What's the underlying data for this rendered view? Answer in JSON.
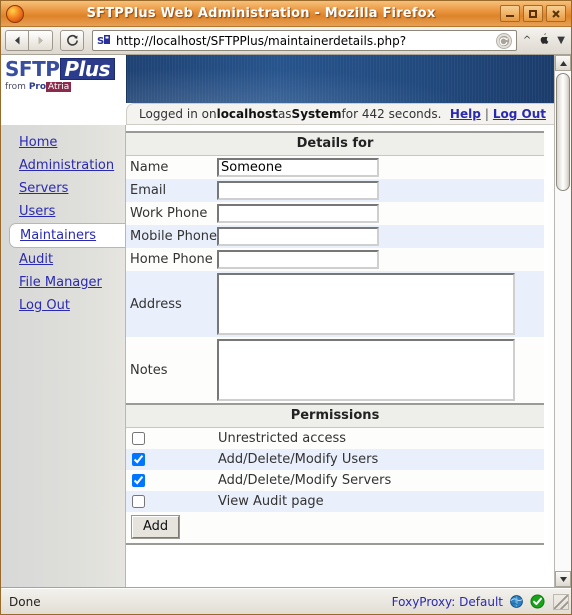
{
  "window": {
    "title": "SFTPPlus Web Administration - Mozilla Firefox",
    "minimize_label": "_",
    "maximize_label": "□",
    "close_label": "✕"
  },
  "toolbar": {
    "back_label": "◀",
    "forward_label": "▶",
    "reload_label": "↻",
    "favicon_label": "S",
    "url": "http://localhost/SFTPPlus/maintainerdetails.php?",
    "go_label": "↺",
    "extra_caret": "^",
    "extra_dropdown": "▼"
  },
  "site": {
    "logo_sftp": "SFTP",
    "logo_plus": "Plus",
    "logo_sub_from": "from ",
    "logo_sub_pro": "Pro",
    "logo_sub_atria": "Atria"
  },
  "login": {
    "prefix": "Logged in on ",
    "host": "localhost",
    "middle": " as ",
    "user": "System",
    "suffix": " for 442 seconds.",
    "help_label": "Help",
    "separator": "|",
    "logout_label": "Log Out"
  },
  "sidebar": {
    "items": [
      {
        "label": "Home",
        "active": false
      },
      {
        "label": "Administration",
        "active": false
      },
      {
        "label": "Servers",
        "active": false
      },
      {
        "label": "Users",
        "active": false
      },
      {
        "label": "Maintainers",
        "active": true
      },
      {
        "label": "Audit",
        "active": false
      },
      {
        "label": "File Manager",
        "active": false
      },
      {
        "label": "Log Out",
        "active": false
      }
    ]
  },
  "details": {
    "heading": "Details for",
    "fields": [
      {
        "label": "Name",
        "value": "Someone",
        "type": "text"
      },
      {
        "label": "Email",
        "value": "",
        "type": "text"
      },
      {
        "label": "Work Phone",
        "value": "",
        "type": "text"
      },
      {
        "label": "Mobile Phone",
        "value": "",
        "type": "text"
      },
      {
        "label": "Home Phone",
        "value": "",
        "type": "text"
      },
      {
        "label": "Address",
        "value": "",
        "type": "textarea"
      },
      {
        "label": "Notes",
        "value": "",
        "type": "textarea"
      }
    ]
  },
  "permissions": {
    "heading": "Permissions",
    "items": [
      {
        "label": "Unrestricted access",
        "checked": false
      },
      {
        "label": "Add/Delete/Modify Users",
        "checked": true
      },
      {
        "label": "Add/Delete/Modify Servers",
        "checked": true
      },
      {
        "label": "View Audit page",
        "checked": false
      }
    ],
    "add_button_label": "Add"
  },
  "statusbar": {
    "status_text": "Done",
    "foxyproxy_label": "FoxyProxy: Default"
  },
  "colors": {
    "titlebar_orange": "#e8913a",
    "banner_blue": "#27548c",
    "link_blue": "#2a2ab0",
    "row_alt_blue": "#e9effb",
    "row_alt_white": "#fdfdfb",
    "panel_head_grey": "#eeeeea",
    "green_check": "#19a319"
  }
}
